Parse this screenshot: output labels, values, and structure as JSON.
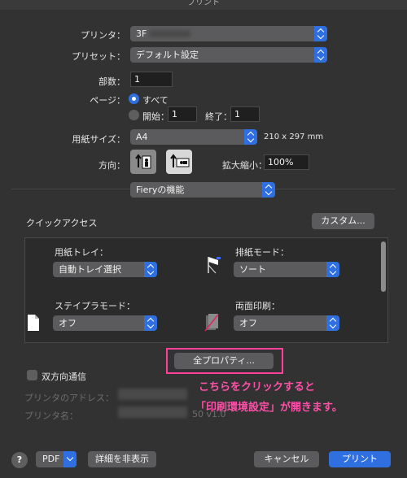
{
  "window": {
    "title": "プリント"
  },
  "printer": {
    "label": "プリンタ：",
    "value": "3F"
  },
  "preset": {
    "label": "プリセット：",
    "value": "デフォルト設定"
  },
  "copies": {
    "label": "部数：",
    "value": "1"
  },
  "pages": {
    "label": "ページ：",
    "all_label": "すべて",
    "from_label": "開始：",
    "from_value": "1",
    "to_label": "終了：",
    "to_value": "1"
  },
  "paper_size": {
    "label": "用紙サイズ：",
    "value": "A4",
    "dimensions": "210 x 297 mm"
  },
  "orientation": {
    "label": "方向："
  },
  "scale": {
    "label": "拡大縮小：",
    "value": "100%"
  },
  "section_menu": {
    "value": "Fieryの機能"
  },
  "quick_access": {
    "title": "クイックアクセス",
    "customize_label": "カスタム...",
    "paper_tray": {
      "label": "用紙トレイ：",
      "value": "自動トレイ選択"
    },
    "output_mode": {
      "label": "排紙モード：",
      "value": "ソート"
    },
    "staple_mode": {
      "label": "ステイプラモード：",
      "value": "オフ"
    },
    "duplex": {
      "label": "両面印刷：",
      "value": "オフ"
    }
  },
  "all_properties": {
    "label": "全プロパティ..."
  },
  "bidirectional": {
    "label": "双方向通信"
  },
  "printer_address": {
    "label": "プリンタのアドレス："
  },
  "printer_name": {
    "label": "プリンタ名：",
    "suffix": "50 v1.0"
  },
  "annotation": {
    "line1": "こちらをクリックすると",
    "line2": "「印刷環境設定」が開きます。"
  },
  "footer": {
    "help": "?",
    "pdf_label": "PDF",
    "hide_details": "詳細を非表示",
    "cancel": "キャンセル",
    "print": "プリント"
  },
  "colors": {
    "accent": "#2f6fe0",
    "annotation": "#ff3f9a"
  }
}
